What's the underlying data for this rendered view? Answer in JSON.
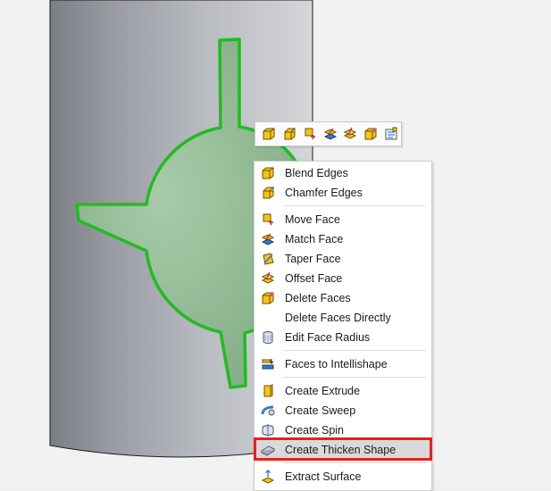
{
  "toolbar": {
    "icons": [
      "blend-edges-icon",
      "chamfer-edges-icon",
      "move-face-icon",
      "match-face-icon",
      "offset-face-icon",
      "delete-faces-icon",
      "properties-icon"
    ]
  },
  "menu": {
    "blend_edges": "Blend Edges",
    "chamfer_edges": "Chamfer Edges",
    "move_face": "Move Face",
    "match_face": "Match Face",
    "taper_face": "Taper Face",
    "offset_face": "Offset Face",
    "delete_faces": "Delete Faces",
    "delete_faces_directly": "Delete Faces Directly",
    "edit_face_radius": "Edit Face Radius",
    "faces_to_intellishape": "Faces to Intellishape",
    "create_extrude": "Create Extrude",
    "create_sweep": "Create Sweep",
    "create_spin": "Create Spin",
    "create_thicken_shape": "Create Thicken Shape",
    "extract_surface": "Extract Surface"
  },
  "colors": {
    "selection_outline": "#22bb22",
    "highlight_border": "#e8201a",
    "icon_yellow": "#f5c518",
    "icon_blue": "#3a78c9"
  }
}
